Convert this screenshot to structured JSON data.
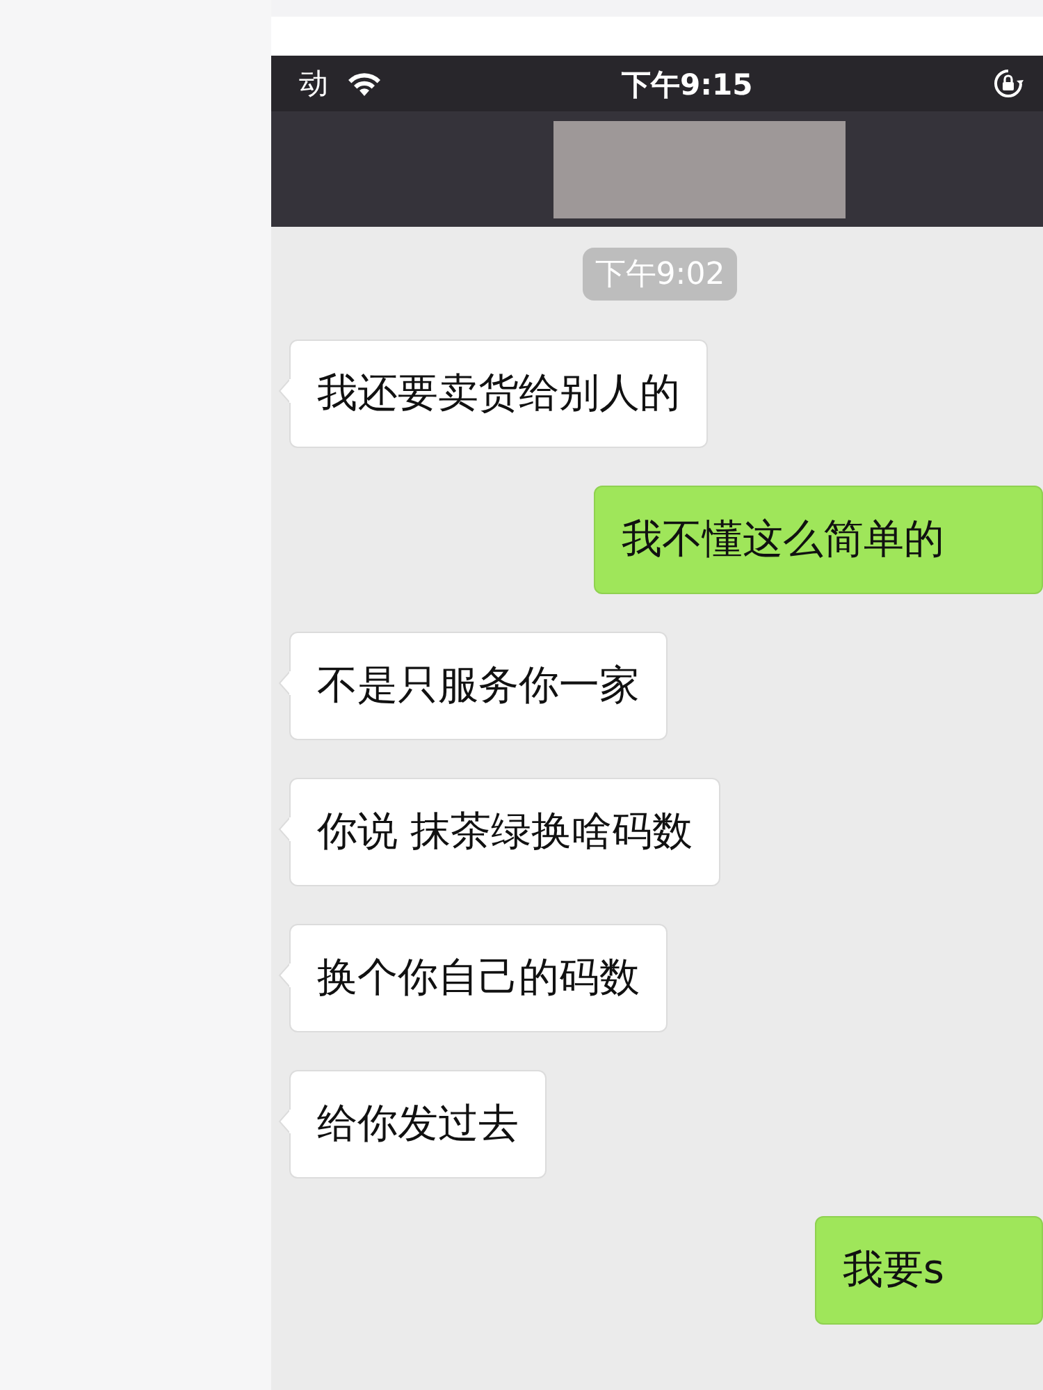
{
  "status_bar": {
    "carrier": "动",
    "time": "下午9:15"
  },
  "chat": {
    "timestamp": "下午9:02",
    "messages": [
      {
        "text": "我还要卖货给别人的",
        "outgoing": false
      },
      {
        "text": "我不懂这么简单的",
        "outgoing": true
      },
      {
        "text": "不是只服务你一家",
        "outgoing": false
      },
      {
        "text": "你说 抹茶绿换啥码数",
        "outgoing": false
      },
      {
        "text": "换个你自己的码数",
        "outgoing": false
      },
      {
        "text": "给你发过去",
        "outgoing": false
      },
      {
        "text": "我要s",
        "outgoing": true
      }
    ]
  }
}
